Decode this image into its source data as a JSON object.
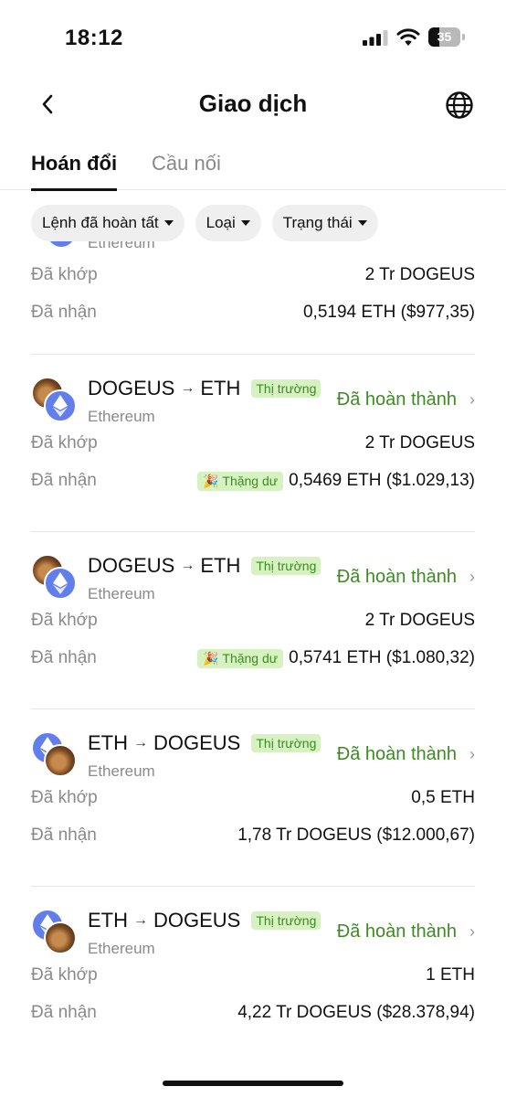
{
  "status_bar": {
    "time": "18:12",
    "battery": "35",
    "battery_level": 0.35
  },
  "header": {
    "title": "Giao dịch",
    "back_icon": "chevron-left-icon",
    "globe_icon": "globe-icon"
  },
  "tabs": [
    {
      "label": "Hoán đổi",
      "active": true
    },
    {
      "label": "Cầu nối",
      "active": false
    }
  ],
  "filters": [
    {
      "label": "Lệnh đã hoàn tất"
    },
    {
      "label": "Loại"
    },
    {
      "label": "Trạng thái"
    }
  ],
  "labels": {
    "matched": "Đã khớp",
    "received": "Đã nhận"
  },
  "partial_card": {
    "network": "Ethereum",
    "matched": "2 Tr DOGEUS",
    "received": "0,5194 ETH ($977,35)"
  },
  "transactions": [
    {
      "from": "DOGEUS",
      "to": "ETH",
      "badge": "Thị trường",
      "network": "Ethereum",
      "status": "Đã hoàn thành",
      "matched": "2 Tr DOGEUS",
      "surplus": "Thặng dư",
      "received": "0,5469 ETH ($1.029,13)"
    },
    {
      "from": "DOGEUS",
      "to": "ETH",
      "badge": "Thị trường",
      "network": "Ethereum",
      "status": "Đã hoàn thành",
      "matched": "2 Tr DOGEUS",
      "surplus": "Thặng dư",
      "received": "0,5741 ETH ($1.080,32)"
    },
    {
      "from": "ETH",
      "to": "DOGEUS",
      "badge": "Thị trường",
      "network": "Ethereum",
      "status": "Đã hoàn thành",
      "matched": "0,5 ETH",
      "received": "1,78 Tr DOGEUS ($12.000,67)"
    },
    {
      "from": "ETH",
      "to": "DOGEUS",
      "badge": "Thị trường",
      "network": "Ethereum",
      "status": "Đã hoàn thành",
      "matched": "1 ETH",
      "received": "4,22 Tr DOGEUS ($28.378,94)"
    }
  ],
  "colors": {
    "accent_green": "#3e8a24",
    "badge_bg": "#d7f2c1",
    "eth_blue": "#627eea"
  }
}
